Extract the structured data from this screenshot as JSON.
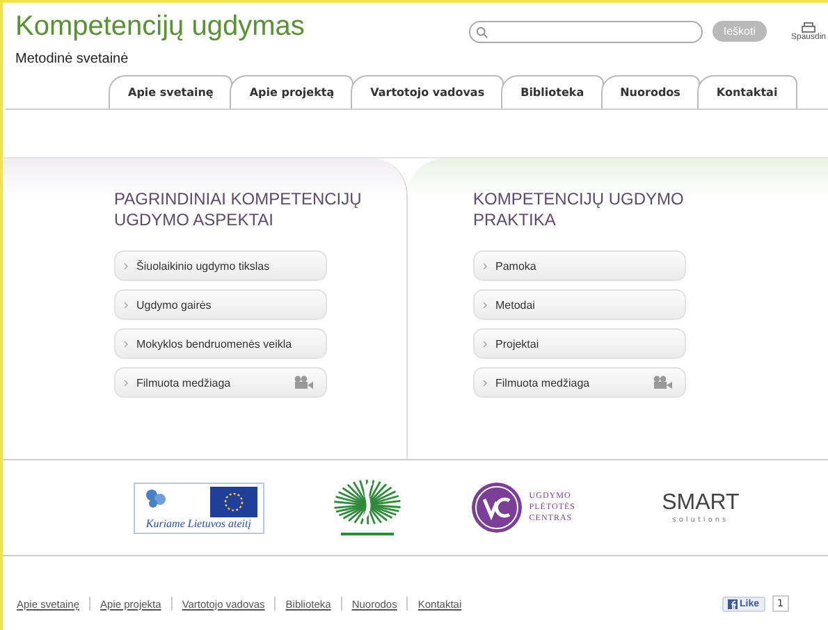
{
  "header": {
    "title": "Kompetencijų ugdymas",
    "subtitle": "Metodinė svetainė",
    "search": {
      "button": "Ieškoti"
    },
    "print": {
      "label": "Spausdin"
    }
  },
  "tabs": [
    {
      "label": "Apie svetainę",
      "selected": false
    },
    {
      "label": "Apie projektą",
      "selected": false
    },
    {
      "label": "Vartotojo vadovas",
      "selected": false
    },
    {
      "label": "Biblioteka",
      "selected": false
    },
    {
      "label": "Nuorodos",
      "selected": false
    },
    {
      "label": "Kontaktai",
      "selected": false
    }
  ],
  "columns": [
    {
      "heading": "PAGRINDINIAI KOMPETENCIJŲ UGDYMO ASPEKTAI",
      "items": [
        {
          "label": "Šiuolaikinio ugdymo tikslas",
          "kind": "link"
        },
        {
          "label": "Ugdymo gairės",
          "kind": "link"
        },
        {
          "label": "Mokyklos bendruomenės veikla",
          "kind": "link"
        },
        {
          "label": "Filmuota medžiaga",
          "kind": "video"
        }
      ]
    },
    {
      "heading": "KOMPETENCIJŲ UGDYMO PRAKTIKA",
      "items": [
        {
          "label": "Pamoka",
          "kind": "link"
        },
        {
          "label": "Metodai",
          "kind": "link"
        },
        {
          "label": "Projektai",
          "kind": "link"
        },
        {
          "label": "Filmuota medžiaga",
          "kind": "video"
        }
      ]
    }
  ],
  "logos": [
    {
      "kind": "eu",
      "text": "Kuriame Lietuvos ateitį"
    },
    {
      "kind": "emblem"
    },
    {
      "kind": "upc",
      "text": "UGDYMO PLĖTOTĖS CENTRAS"
    },
    {
      "kind": "smart",
      "text": "SMART",
      "subtext": "solutions"
    }
  ],
  "footer": {
    "links": [
      "Apie svetainę",
      "Apie projekta",
      "Vartotojo vadovas",
      "Biblioteka",
      "Nuorodos",
      "Kontaktai"
    ],
    "like": {
      "label": "Like",
      "count": "1"
    }
  }
}
